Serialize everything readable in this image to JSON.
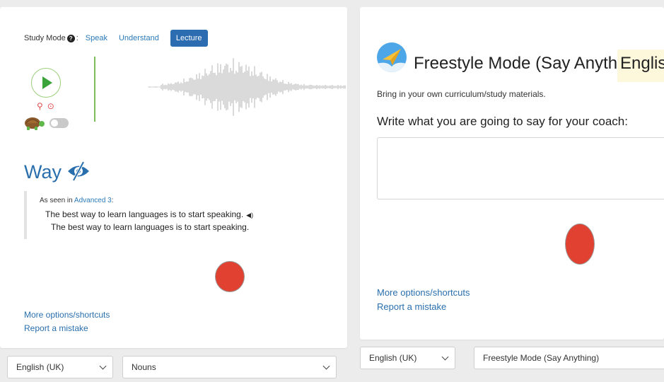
{
  "left": {
    "study_mode_label": "Study Mode",
    "study_mode_help": "?",
    "study_mode_colon": ":",
    "tabs": [
      {
        "label": "Speak",
        "active": false
      },
      {
        "label": "Understand",
        "active": false
      },
      {
        "label": "Lecture",
        "active": true
      }
    ],
    "word": "Way",
    "example": {
      "seen_prefix": "As seen in ",
      "seen_link": "Advanced 3",
      "seen_suffix": ":",
      "sentence": "The best way to learn languages is to start speaking.",
      "translation": "The best way to learn languages is to start speaking."
    },
    "links": {
      "more_options": "More options/shortcuts",
      "report": "Report a mistake"
    }
  },
  "right": {
    "title": "Freestyle Mode (Say Anything) |",
    "title_lang": "English",
    "subtitle": "Bring in your own curriculum/study materials.",
    "prompt": "Write what you are going to say for your coach:",
    "textarea_value": "",
    "links": {
      "more_options": "More options/shortcuts",
      "report": "Report a mistake"
    }
  },
  "bottom": {
    "left_language": "English (UK)",
    "left_category": "Nouns",
    "right_language": "English (UK)",
    "right_mode": "Freestyle Mode (Say Anything)"
  },
  "colors": {
    "accent_blue": "#2c6cb0",
    "link_blue": "#2a6fad",
    "record_red": "#e04130",
    "play_green": "#3aa33a"
  },
  "icons": {
    "help": "question-circle-icon",
    "play": "play-icon",
    "pin": "pin-icon",
    "replay": "circle-play-icon",
    "turtle": "turtle-icon",
    "hide": "eye-slash-icon",
    "speaker": "speaker-icon",
    "plane": "paper-plane-icon",
    "chevron": "chevron-down-icon"
  }
}
